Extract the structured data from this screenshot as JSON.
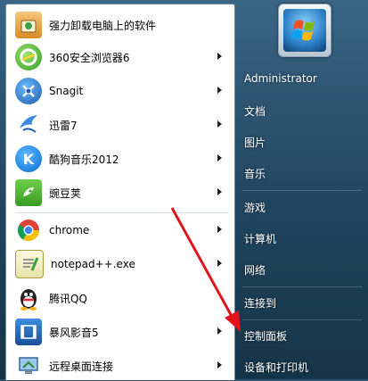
{
  "programs": [
    {
      "label": "强力卸载电脑上的软件",
      "icon": "uninstaller-icon",
      "has_arrow": false
    },
    {
      "label": "360安全浏览器6",
      "icon": "360-browser-icon",
      "has_arrow": true
    },
    {
      "label": "Snagit",
      "icon": "snagit-icon",
      "has_arrow": true
    },
    {
      "label": "迅雷7",
      "icon": "thunder-icon",
      "has_arrow": true
    },
    {
      "label": "酷狗音乐2012",
      "icon": "kugou-icon",
      "has_arrow": true
    },
    {
      "label": "豌豆荚",
      "icon": "wandoujia-icon",
      "has_arrow": true
    },
    {
      "label": "chrome",
      "icon": "chrome-icon",
      "has_arrow": true
    },
    {
      "label": "notepad++.exe",
      "icon": "notepadpp-icon",
      "has_arrow": true
    },
    {
      "label": "腾讯QQ",
      "icon": "qq-icon",
      "has_arrow": false
    },
    {
      "label": "暴风影音5",
      "icon": "baofeng-icon",
      "has_arrow": true
    },
    {
      "label": "远程桌面连接",
      "icon": "remote-desktop-icon",
      "has_arrow": true
    }
  ],
  "right": {
    "user": "Administrator",
    "items": [
      "文档",
      "图片",
      "音乐",
      "游戏",
      "计算机",
      "网络",
      "连接到",
      "控制面板",
      "设备和打印机"
    ]
  },
  "colors": {
    "arrow": "#e0141b",
    "frame": "#2c5470"
  }
}
